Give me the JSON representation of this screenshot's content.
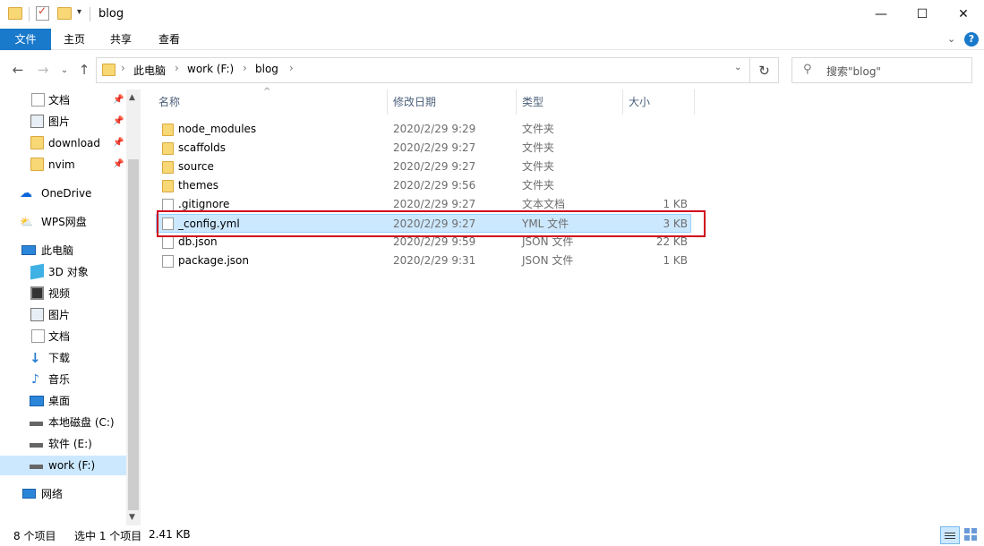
{
  "window": {
    "title": "blog"
  },
  "window_controls": {
    "minimize": "—",
    "maximize": "☐",
    "close": "✕"
  },
  "ribbon": {
    "tabs": [
      "文件",
      "主页",
      "共享",
      "查看"
    ],
    "active_tab": "文件",
    "accent": "#1979ca"
  },
  "address": {
    "crumbs": [
      "此电脑",
      "work (F:)",
      "blog"
    ],
    "separator": "›"
  },
  "search": {
    "placeholder": "搜索\"blog\""
  },
  "sidebar": {
    "quick_access": [
      {
        "label": "文档",
        "icon": "document-icon",
        "pinned": true
      },
      {
        "label": "图片",
        "icon": "picture-icon",
        "pinned": true
      },
      {
        "label": "download",
        "icon": "folder-icon",
        "pinned": true
      },
      {
        "label": "nvim",
        "icon": "folder-icon",
        "pinned": true
      }
    ],
    "onedrive": "OneDrive",
    "wps": "WPS网盘",
    "this_pc": "此电脑",
    "this_pc_items": [
      {
        "label": "3D 对象",
        "icon": "3d-objects-icon"
      },
      {
        "label": "视频",
        "icon": "video-icon"
      },
      {
        "label": "图片",
        "icon": "picture-icon"
      },
      {
        "label": "文档",
        "icon": "document-icon"
      },
      {
        "label": "下载",
        "icon": "download-icon"
      },
      {
        "label": "音乐",
        "icon": "music-icon"
      },
      {
        "label": "桌面",
        "icon": "desktop-icon"
      },
      {
        "label": "本地磁盘 (C:)",
        "icon": "drive-c-icon"
      },
      {
        "label": "软件 (E:)",
        "icon": "drive-icon"
      },
      {
        "label": "work (F:)",
        "icon": "drive-icon",
        "selected": true
      }
    ],
    "network": "网络"
  },
  "columns": {
    "name": "名称",
    "date": "修改日期",
    "type": "类型",
    "size": "大小"
  },
  "files": [
    {
      "name": "node_modules",
      "date": "2020/2/29 9:29",
      "type": "文件夹",
      "size": "",
      "kind": "folder"
    },
    {
      "name": "scaffolds",
      "date": "2020/2/29 9:27",
      "type": "文件夹",
      "size": "",
      "kind": "folder"
    },
    {
      "name": "source",
      "date": "2020/2/29 9:27",
      "type": "文件夹",
      "size": "",
      "kind": "folder"
    },
    {
      "name": "themes",
      "date": "2020/2/29 9:56",
      "type": "文件夹",
      "size": "",
      "kind": "folder"
    },
    {
      "name": ".gitignore",
      "date": "2020/2/29 9:27",
      "type": "文本文档",
      "size": "1 KB",
      "kind": "file"
    },
    {
      "name": "_config.yml",
      "date": "2020/2/29 9:27",
      "type": "YML 文件",
      "size": "3 KB",
      "kind": "file",
      "selected": true
    },
    {
      "name": "db.json",
      "date": "2020/2/29 9:59",
      "type": "JSON 文件",
      "size": "22 KB",
      "kind": "file"
    },
    {
      "name": "package.json",
      "date": "2020/2/29 9:31",
      "type": "JSON 文件",
      "size": "1 KB",
      "kind": "file"
    }
  ],
  "status": {
    "count": "8 个项目",
    "selection": "选中 1 个项目",
    "size": "2.41 KB"
  }
}
